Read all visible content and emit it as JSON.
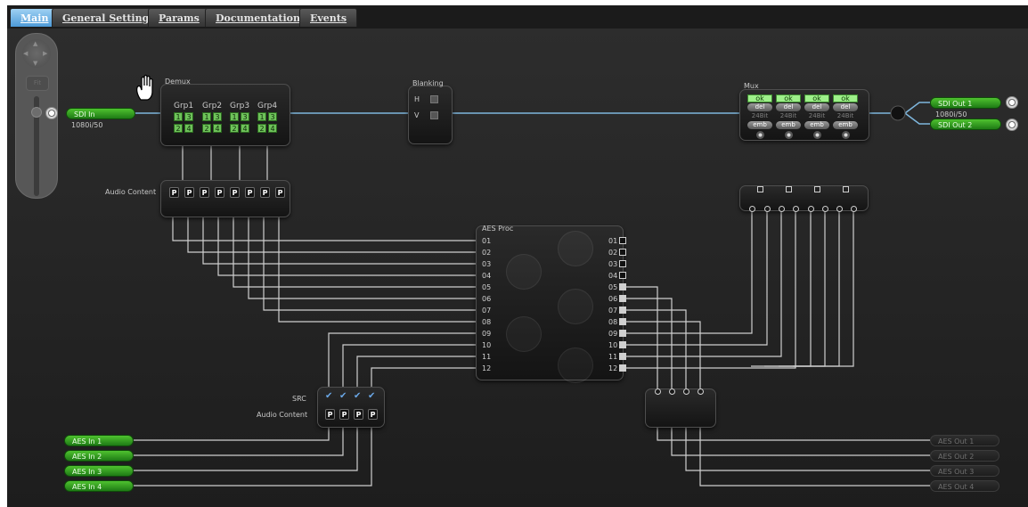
{
  "tabs": [
    {
      "label": "Main",
      "active": true
    },
    {
      "label": "General Settings",
      "active": false
    },
    {
      "label": "Params",
      "active": false
    },
    {
      "label": "Documentation",
      "active": false
    },
    {
      "label": "Events",
      "active": false
    }
  ],
  "nav": {
    "fit_label": "Fit"
  },
  "sdi_in": {
    "label": "SDI In",
    "format": "1080i/50"
  },
  "demux": {
    "title": "Demux",
    "groups": [
      {
        "label": "Grp1",
        "pairs": [
          "1",
          "3",
          "2",
          "4"
        ]
      },
      {
        "label": "Grp2",
        "pairs": [
          "1",
          "3",
          "2",
          "4"
        ]
      },
      {
        "label": "Grp3",
        "pairs": [
          "1",
          "3",
          "2",
          "4"
        ]
      },
      {
        "label": "Grp4",
        "pairs": [
          "1",
          "3",
          "2",
          "4"
        ]
      }
    ]
  },
  "audio_content": {
    "label": "Audio Content",
    "buttons": [
      "P",
      "P",
      "P",
      "P",
      "P",
      "P",
      "P",
      "P"
    ]
  },
  "blanking": {
    "title": "Blanking",
    "h_label": "H",
    "v_label": "V"
  },
  "mux": {
    "title": "Mux",
    "channels": [
      {
        "status": "ok",
        "del": "del",
        "bits": "24Bit",
        "emb": "emb"
      },
      {
        "status": "ok",
        "del": "del",
        "bits": "24Bit",
        "emb": "emb"
      },
      {
        "status": "ok",
        "del": "del",
        "bits": "24Bit",
        "emb": "emb"
      },
      {
        "status": "ok",
        "del": "del",
        "bits": "24Bit",
        "emb": "emb"
      }
    ]
  },
  "sdi_out": [
    {
      "label": "SDI Out 1",
      "format": "1080i/50"
    },
    {
      "label": "SDI Out 2"
    }
  ],
  "aes_proc": {
    "title": "AES Proc",
    "inputs": [
      "01",
      "02",
      "03",
      "04",
      "05",
      "06",
      "07",
      "08",
      "09",
      "10",
      "11",
      "12"
    ],
    "outputs": [
      "01",
      "02",
      "03",
      "04",
      "05",
      "06",
      "07",
      "08",
      "09",
      "10",
      "11",
      "12"
    ]
  },
  "src": {
    "label": "SRC",
    "audio_content_label": "Audio Content",
    "buttons": [
      "P",
      "P",
      "P",
      "P"
    ]
  },
  "aes_in": [
    "AES In 1",
    "AES In 2",
    "AES In 3",
    "AES In 4"
  ],
  "aes_out": [
    "AES Out 1",
    "AES Out 2",
    "AES Out 3",
    "AES Out 4"
  ],
  "colors": {
    "tab_active": "#5aa8e6",
    "green": "#3aa82a",
    "wire": "#cfcfcf",
    "sdi_line": "#7eb6dc"
  }
}
